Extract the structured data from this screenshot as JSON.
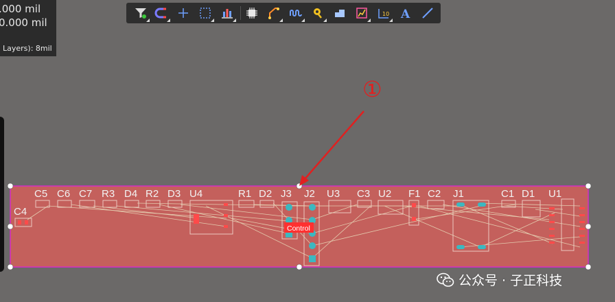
{
  "info_panel": {
    "line1": ".000  mil",
    "line2": "0.000 mil",
    "line3": "Layers): 8mil"
  },
  "toolbar": {
    "tools": [
      {
        "icon": "filter-icon",
        "label": "Filter"
      },
      {
        "icon": "magnet-icon",
        "label": "Snap"
      },
      {
        "icon": "crosshair-icon",
        "label": "Place"
      },
      {
        "icon": "select-rect-icon",
        "label": "Select"
      },
      {
        "icon": "align-icon",
        "label": "Align"
      },
      {
        "icon": "component-icon",
        "label": "Component"
      },
      {
        "icon": "route-icon",
        "label": "Route"
      },
      {
        "icon": "tune-icon",
        "label": "Interactive Length Tuning"
      },
      {
        "icon": "via-icon",
        "label": "Via"
      },
      {
        "icon": "polygon-icon",
        "label": "Polygon"
      },
      {
        "icon": "keepout-icon",
        "label": "Keepout"
      },
      {
        "icon": "dimension-icon",
        "label": "Dimension"
      },
      {
        "icon": "text-icon",
        "label": "Text"
      },
      {
        "icon": "line-icon",
        "label": "Line"
      }
    ]
  },
  "annotation": {
    "label": "①",
    "color": "#e02020"
  },
  "board": {
    "fill": "#c4605c",
    "outline": "#d62cc8",
    "components": [
      {
        "ref": "C4"
      },
      {
        "ref": "C5"
      },
      {
        "ref": "C6"
      },
      {
        "ref": "C7"
      },
      {
        "ref": "R3"
      },
      {
        "ref": "D4"
      },
      {
        "ref": "R2"
      },
      {
        "ref": "D3"
      },
      {
        "ref": "U4"
      },
      {
        "ref": "R1"
      },
      {
        "ref": "D2"
      },
      {
        "ref": "J3"
      },
      {
        "ref": "J2"
      },
      {
        "ref": "U3"
      },
      {
        "ref": "C3"
      },
      {
        "ref": "U2"
      },
      {
        "ref": "F1"
      },
      {
        "ref": "C2"
      },
      {
        "ref": "J1"
      },
      {
        "ref": "C1"
      },
      {
        "ref": "D1"
      },
      {
        "ref": "U1"
      }
    ],
    "net_label": "Control"
  },
  "watermark": {
    "text": "公众号 · 子正科技",
    "icon": "wechat-icon"
  }
}
